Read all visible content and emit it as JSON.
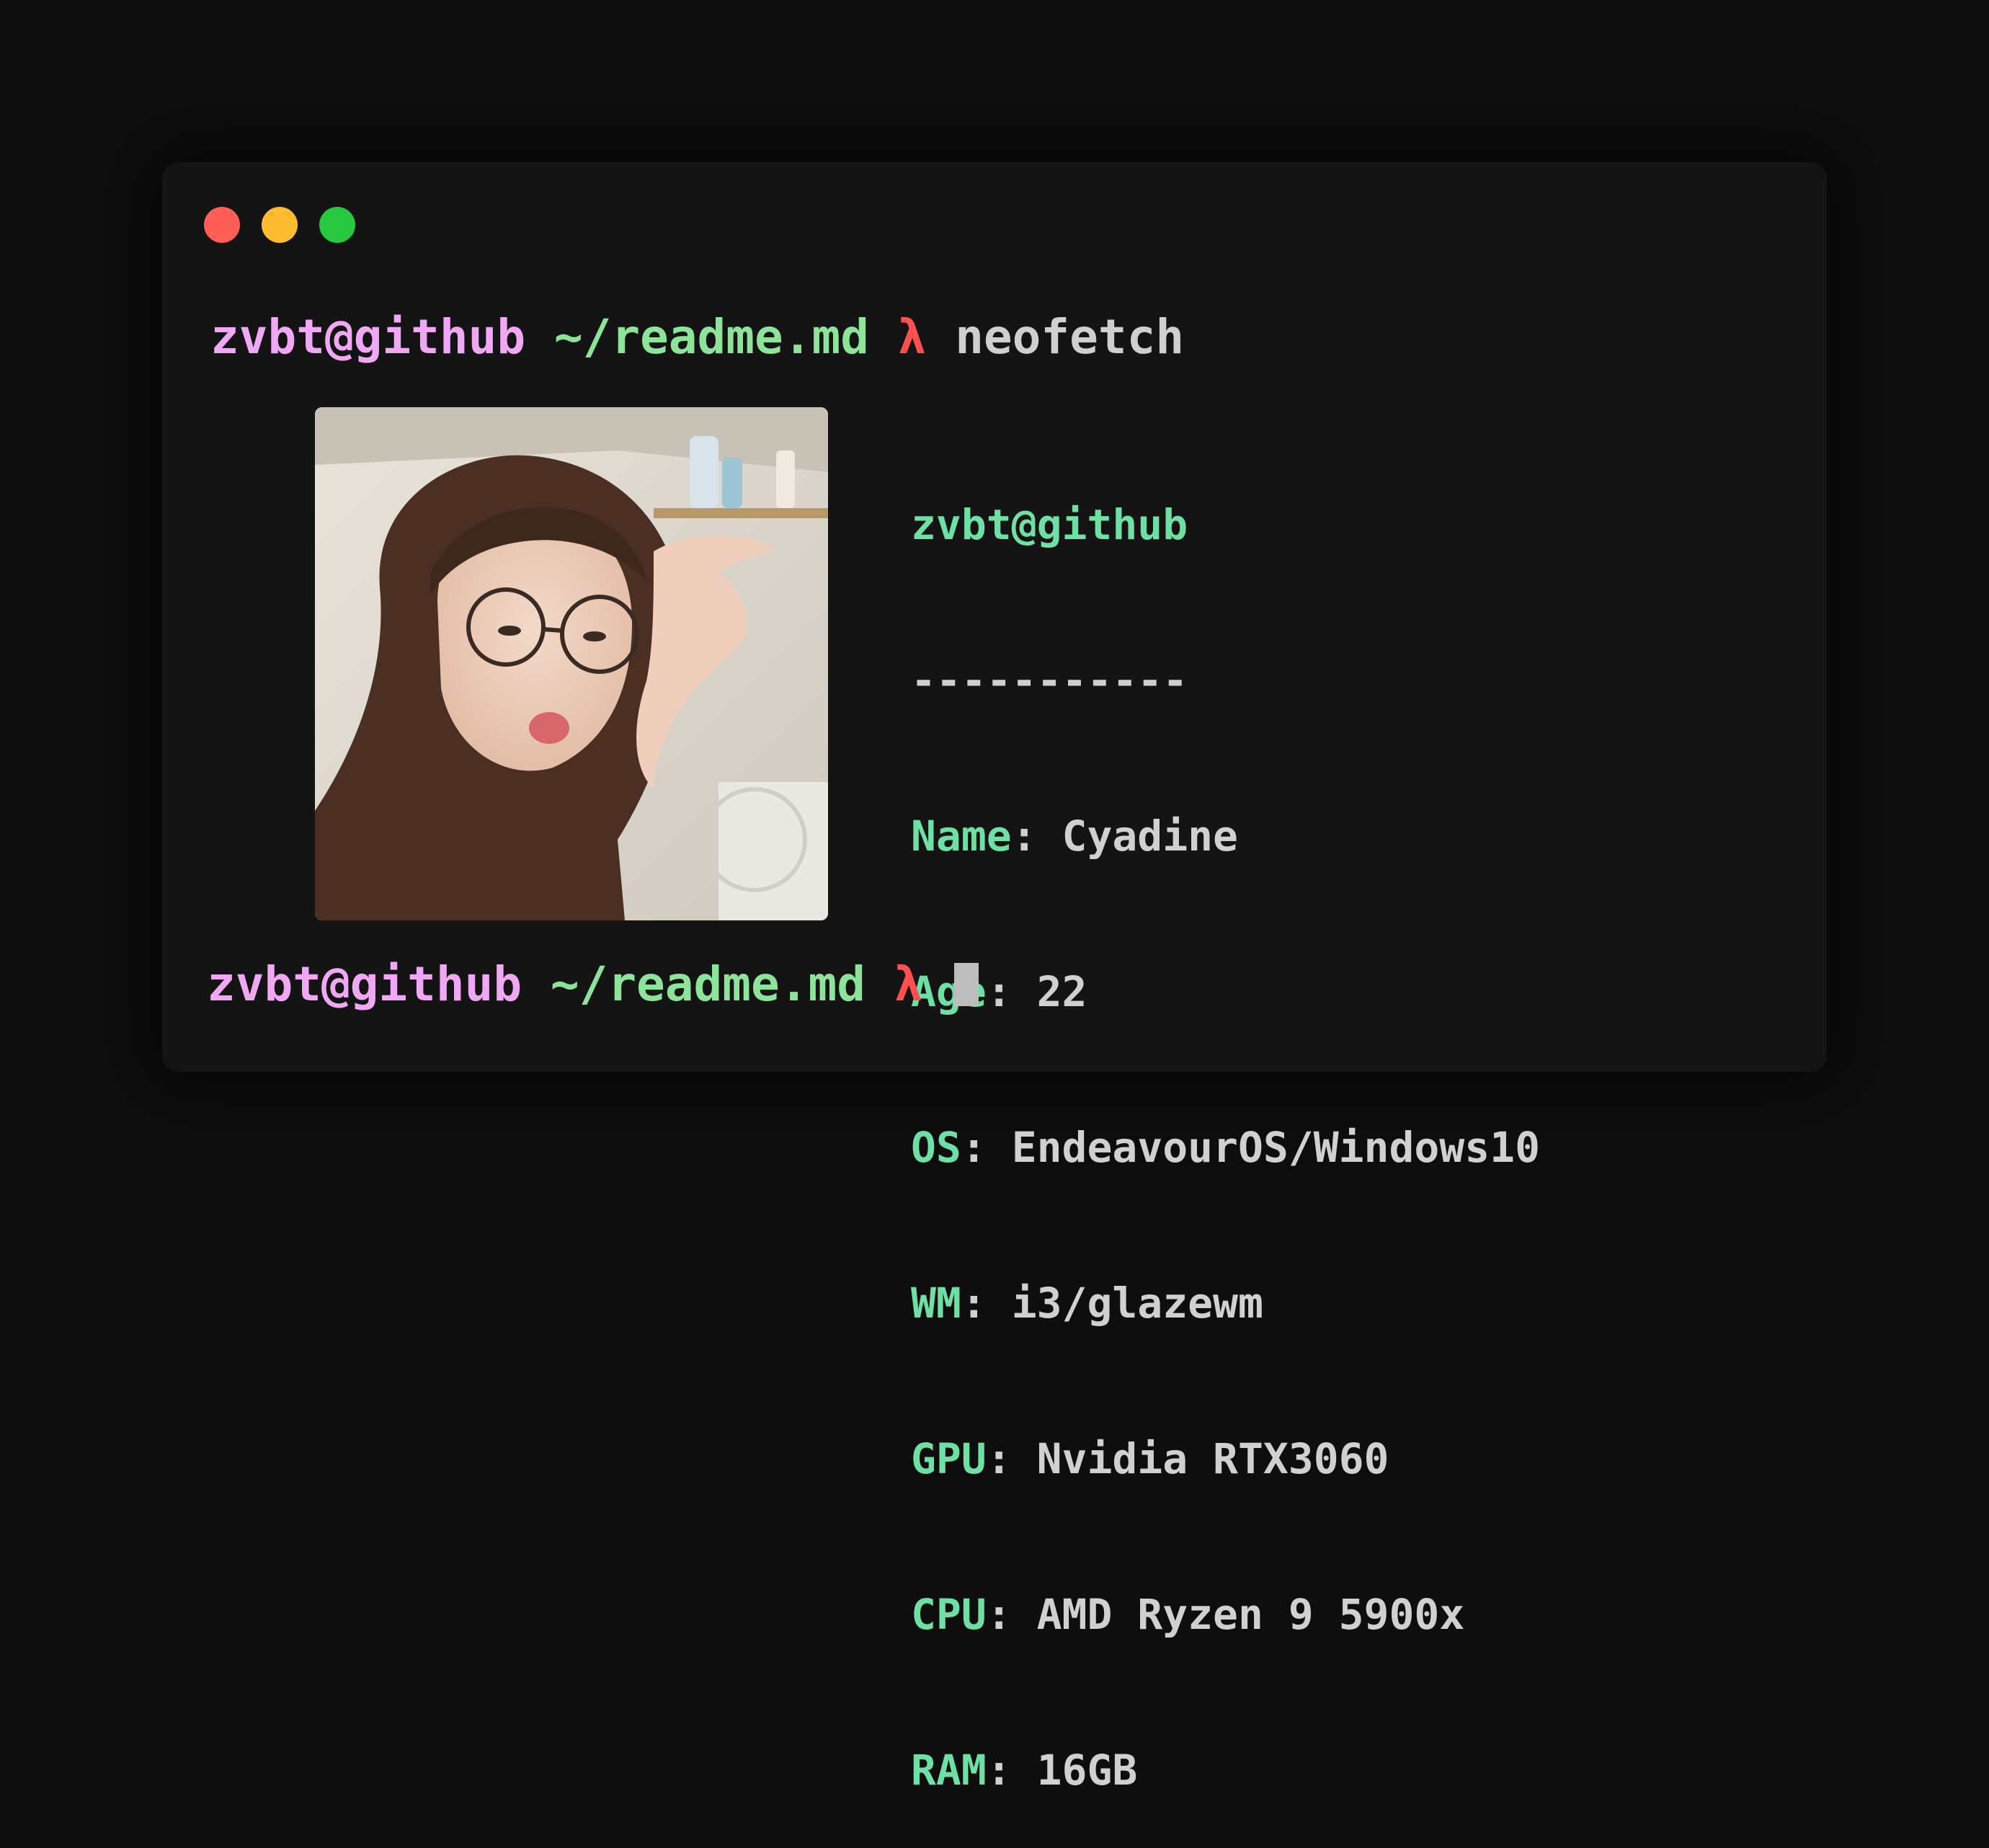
{
  "window": {
    "controls": [
      "close",
      "minimize",
      "maximize"
    ],
    "colors": {
      "close": "#ff5f57",
      "minimize": "#febc2e",
      "maximize": "#28c840"
    }
  },
  "prompt": {
    "user": "zvbt@github",
    "path": "~/readme.md",
    "symbol": "λ"
  },
  "command": "neofetch",
  "neofetch": {
    "title": "zvbt@github",
    "separator": "-----------",
    "fields": [
      {
        "key": "Name",
        "value": "Cyadine"
      },
      {
        "key": "Age",
        "value": "22"
      },
      {
        "key": "OS",
        "value": "EndeavourOS/Windows10"
      },
      {
        "key": "WM",
        "value": "i3/glazewm"
      },
      {
        "key": "GPU",
        "value": "Nvidia RTX3060"
      },
      {
        "key": "CPU",
        "value": "AMD Ryzen 9 5900x"
      },
      {
        "key": "RAM",
        "value": "16GB"
      }
    ]
  },
  "colors": {
    "user": "#f0a8f5",
    "path": "#8ee39a",
    "lambda": "#ff4f4f",
    "key": "#6ee0a4",
    "text": "#cfcfcf"
  }
}
